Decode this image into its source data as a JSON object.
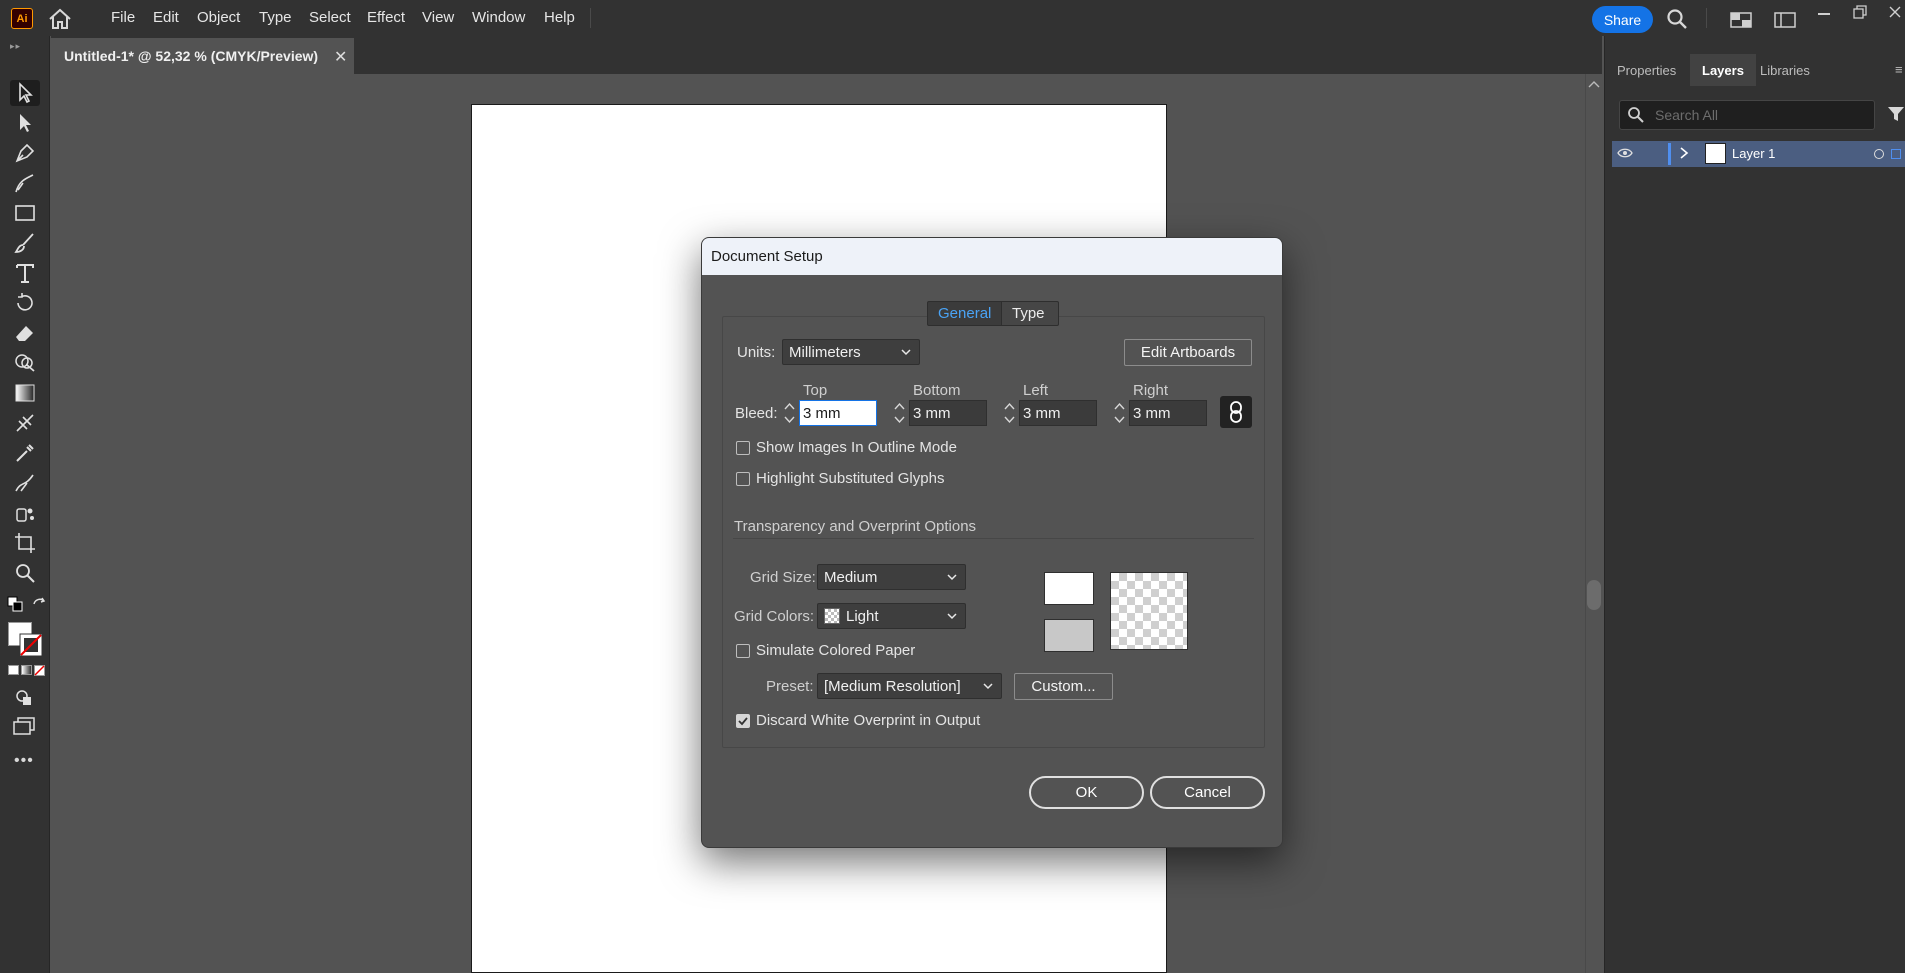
{
  "app": {
    "logo_text": "Ai",
    "menu": [
      "File",
      "Edit",
      "Object",
      "Type",
      "Select",
      "Effect",
      "View",
      "Window",
      "Help"
    ],
    "share_label": "Share",
    "accent": "#1473e6"
  },
  "document_tab": {
    "title": "Untitled-1* @ 52,32 % (CMYK/Preview)",
    "close": "✕"
  },
  "right_panel": {
    "tabs": [
      "Properties",
      "Layers",
      "Libraries"
    ],
    "active_tab": "Layers",
    "search_placeholder": "Search All",
    "layers": [
      {
        "name": "Layer 1"
      }
    ]
  },
  "dialog": {
    "title": "Document Setup",
    "tabs": [
      "General",
      "Type"
    ],
    "active_tab": "General",
    "units_label": "Units:",
    "units_value": "Millimeters",
    "edit_artboards": "Edit Artboards",
    "bleed_label": "Bleed:",
    "bleed": {
      "top_label": "Top",
      "top_value": "3 mm",
      "bottom_label": "Bottom",
      "bottom_value": "3 mm",
      "left_label": "Left",
      "left_value": "3 mm",
      "right_label": "Right",
      "right_value": "3 mm"
    },
    "show_images_outline": {
      "label": "Show Images In Outline Mode",
      "checked": false
    },
    "highlight_glyphs": {
      "label": "Highlight Substituted Glyphs",
      "checked": false
    },
    "section_title": "Transparency and Overprint Options",
    "grid_size_label": "Grid Size:",
    "grid_size_value": "Medium",
    "grid_colors_label": "Grid Colors:",
    "grid_colors_value": "Light",
    "simulate_paper": {
      "label": "Simulate Colored Paper",
      "checked": false
    },
    "preset_label": "Preset:",
    "preset_value": "[Medium Resolution]",
    "custom_button": "Custom...",
    "discard_white": {
      "label": "Discard White Overprint in Output",
      "checked": true
    },
    "ok": "OK",
    "cancel": "Cancel"
  }
}
